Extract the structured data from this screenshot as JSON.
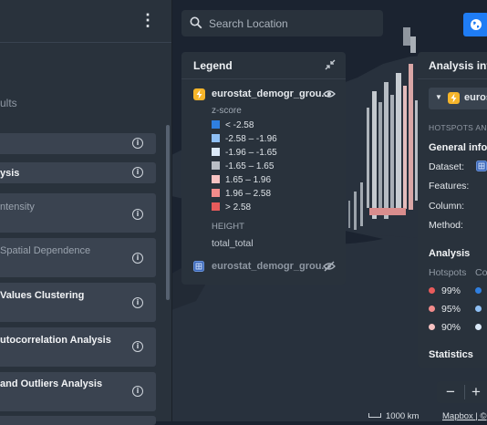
{
  "search": {
    "placeholder": "Search Location"
  },
  "left_panel": {
    "results_label": "ults",
    "items": [
      {
        "label": ""
      },
      {
        "label": "ysis"
      },
      {
        "label": "ntensity"
      },
      {
        "label": "Spatial Dependence"
      },
      {
        "label": "Values Clustering"
      },
      {
        "label": "utocorrelation Analysis"
      },
      {
        "label": "and Outliers Analysis"
      }
    ]
  },
  "legend": {
    "title": "Legend",
    "layer1_name": "eurostat_demogr_grou...",
    "color_field": "z-score",
    "bins": [
      {
        "label": "< -2.58",
        "color": "#2f7fe0"
      },
      {
        "label": "-2.58 – -1.96",
        "color": "#8fc0f5"
      },
      {
        "label": "-1.96 – -1.65",
        "color": "#dbe9f8"
      },
      {
        "label": "-1.65 – 1.65",
        "color": "#b9bec5"
      },
      {
        "label": "1.65 – 1.96",
        "color": "#f7c2c2"
      },
      {
        "label": "1.96 – 2.58",
        "color": "#f28b8b"
      },
      {
        "label": "> 2.58",
        "color": "#e85b5b"
      }
    ],
    "height_label": "HEIGHT",
    "height_field": "total_total",
    "layer2_name": "eurostat_demogr_grou..."
  },
  "analysis": {
    "title": "Analysis info",
    "dataset_select": "euros",
    "section_caption": "HOTSPOTS AN",
    "general_info": "General info",
    "fields": [
      {
        "label": "Dataset:"
      },
      {
        "label": "Features:"
      },
      {
        "label": "Column:"
      },
      {
        "label": "Method:"
      }
    ],
    "analysis_heading": "Analysis",
    "hotspots_label": "Hotspots",
    "coldspots_label": "Co",
    "hotspot_levels": [
      {
        "label": "99%",
        "color": "#e85b5b"
      },
      {
        "label": "95%",
        "color": "#f28b8b"
      },
      {
        "label": "90%",
        "color": "#f7c2c2"
      }
    ],
    "coldspot_colors": [
      "#2f7fe0",
      "#8fc0f5",
      "#dbe9f8"
    ],
    "statistics_heading": "Statistics"
  },
  "map_footer": {
    "scale": "1000 km",
    "attribution": "Mapbox | ©"
  },
  "icons": {
    "kebab": "more-vertical-icon",
    "search": "search-icon",
    "globe": "globe-icon",
    "collapse": "collapse-icon",
    "bolt": "bolt-icon",
    "eye": "eye-icon",
    "eye_off": "eye-off-icon",
    "grid": "grid-layer-icon",
    "info": "info-icon"
  }
}
